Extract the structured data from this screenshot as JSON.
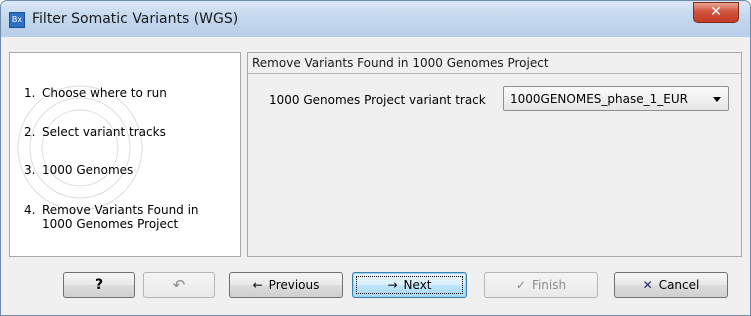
{
  "window": {
    "title": "Filter Somatic Variants (WGS)",
    "app_icon_text": "Bx",
    "close_symbol": "✕"
  },
  "steps": [
    {
      "number": "1.",
      "label": "Choose where to run"
    },
    {
      "number": "2.",
      "label": "Select variant tracks"
    },
    {
      "number": "3.",
      "label": "1000 Genomes"
    },
    {
      "number": "4.",
      "label": "Remove Variants Found in",
      "label_line2": "1000 Genomes Project"
    }
  ],
  "content": {
    "section_title": "Remove Variants Found in 1000 Genomes Project",
    "field_label": "1000 Genomes Project variant track",
    "field_value": "1000GENOMES_phase_1_EUR"
  },
  "buttons": {
    "help": "?",
    "previous": "Previous",
    "next": "Next",
    "finish": "Finish",
    "cancel": "Cancel"
  },
  "icons": {
    "help": "?",
    "reset": "↶",
    "previous": "←",
    "next": "→",
    "finish": "✓",
    "cancel": "✕"
  }
}
